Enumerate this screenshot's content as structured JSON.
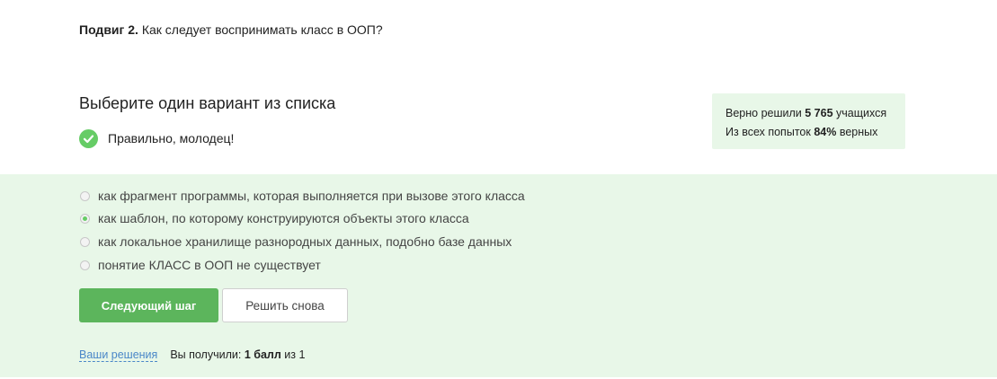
{
  "question": {
    "prefix": "Подвиг 2.",
    "text": "Как следует воспринимать класс в ООП?"
  },
  "task": {
    "heading": "Выберите один вариант из списка",
    "feedback": "Правильно, молодец!"
  },
  "stats": {
    "solved_prefix": "Верно решили",
    "solved_count": "5 765",
    "solved_suffix": "учащихся",
    "attempts_prefix": "Из всех попыток",
    "attempts_percent": "84%",
    "attempts_suffix": "верных"
  },
  "options": [
    {
      "label": "как фрагмент программы, которая выполняется при вызове этого класса",
      "selected": false
    },
    {
      "label": "как шаблон, по которому конструируются объекты этого класса",
      "selected": true
    },
    {
      "label": "как локальное хранилище разнородных данных, подобно базе данных",
      "selected": false
    },
    {
      "label": "понятие КЛАСС в ООП не существует",
      "selected": false
    }
  ],
  "buttons": {
    "next": "Следующий шаг",
    "retry": "Решить снова"
  },
  "footer": {
    "solutions_link": "Ваши решения",
    "score_prefix": "Вы получили:",
    "score_value": "1 балл",
    "score_suffix": "из 1"
  },
  "colors": {
    "accent": "#66cc66",
    "panel_bg": "#e8f7e8",
    "button_green": "#5cb55c",
    "link": "#4a87c8"
  },
  "icons": {
    "feedback": "check-icon"
  }
}
